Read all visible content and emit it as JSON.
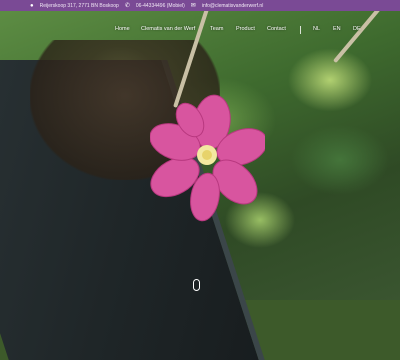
{
  "topbar": {
    "address": "Reijerskoop 317, 2771 BN Boskoop",
    "phone": "06-44334496 (Mobiel)",
    "email": "info@clematisvanderwerf.nl"
  },
  "nav": {
    "items": [
      {
        "label": "Home"
      },
      {
        "label": "Clematis van der Werf"
      },
      {
        "label": "Team"
      },
      {
        "label": "Product"
      },
      {
        "label": "Contact"
      }
    ],
    "languages": [
      "NL",
      "EN",
      "DE"
    ]
  },
  "hero": {
    "scroll_indicator": "0"
  },
  "colors": {
    "topbar": "#7a4a95",
    "flower": "#d8559f",
    "leaf": "#9cc86a"
  }
}
